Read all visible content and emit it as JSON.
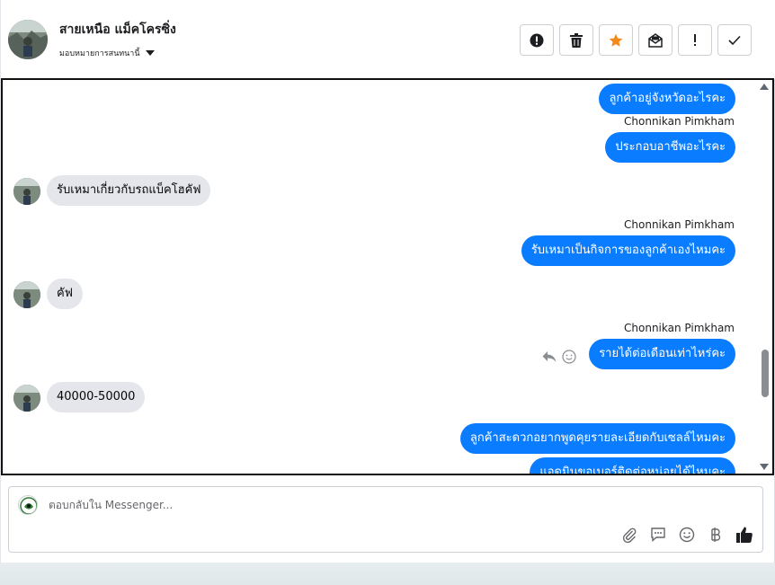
{
  "header": {
    "contact_name": "สายเหนือ แม็คโครซิ่ง",
    "assign_label": "มอบหมายการสนทนานี้",
    "actions": [
      {
        "name": "report-spam-button",
        "icon": "alert-circle-icon"
      },
      {
        "name": "delete-button",
        "icon": "trash-icon"
      },
      {
        "name": "star-button",
        "icon": "star-icon",
        "color": "#f5891b"
      },
      {
        "name": "mark-unread-button",
        "icon": "envelope-icon"
      },
      {
        "name": "priority-button",
        "icon": "exclamation-icon"
      },
      {
        "name": "mark-done-button",
        "icon": "check-icon"
      }
    ]
  },
  "messages": [
    {
      "dir": "out",
      "text": "ลูกค้าอยู่จังหวัดอะไรคะ"
    },
    {
      "dir": "out",
      "sender": "Chonnikan Pimkham",
      "text": "ประกอบอาชีพอะไรคะ"
    },
    {
      "dir": "in",
      "text": "รับเหมาเกี่ยวกับรถแบ็คโฮคัฟ"
    },
    {
      "dir": "out",
      "sender": "Chonnikan Pimkham",
      "text": "รับเหมาเป็นกิจการของลูกค้าเองไหมคะ"
    },
    {
      "dir": "in",
      "text": "คัฟ"
    },
    {
      "dir": "out",
      "sender": "Chonnikan Pimkham",
      "text": "รายได้ต่อเดือนเท่าไหร่คะ"
    },
    {
      "dir": "in",
      "text": "40000-50000"
    },
    {
      "dir": "out",
      "text": "ลูกค้าสะดวกอยากพูดคุยรายละเอียดกับเซลล์ไหมคะ"
    },
    {
      "dir": "out",
      "text": "แอดมินขอเบอร์ติดต่อหน่อยได้ไหมคะ"
    }
  ],
  "composer": {
    "placeholder": "ตอบกลับใน Messenger..."
  },
  "colors": {
    "outgoing_bubble": "#0a7cff",
    "incoming_bubble": "#e4e6eb",
    "star": "#f5891b"
  }
}
